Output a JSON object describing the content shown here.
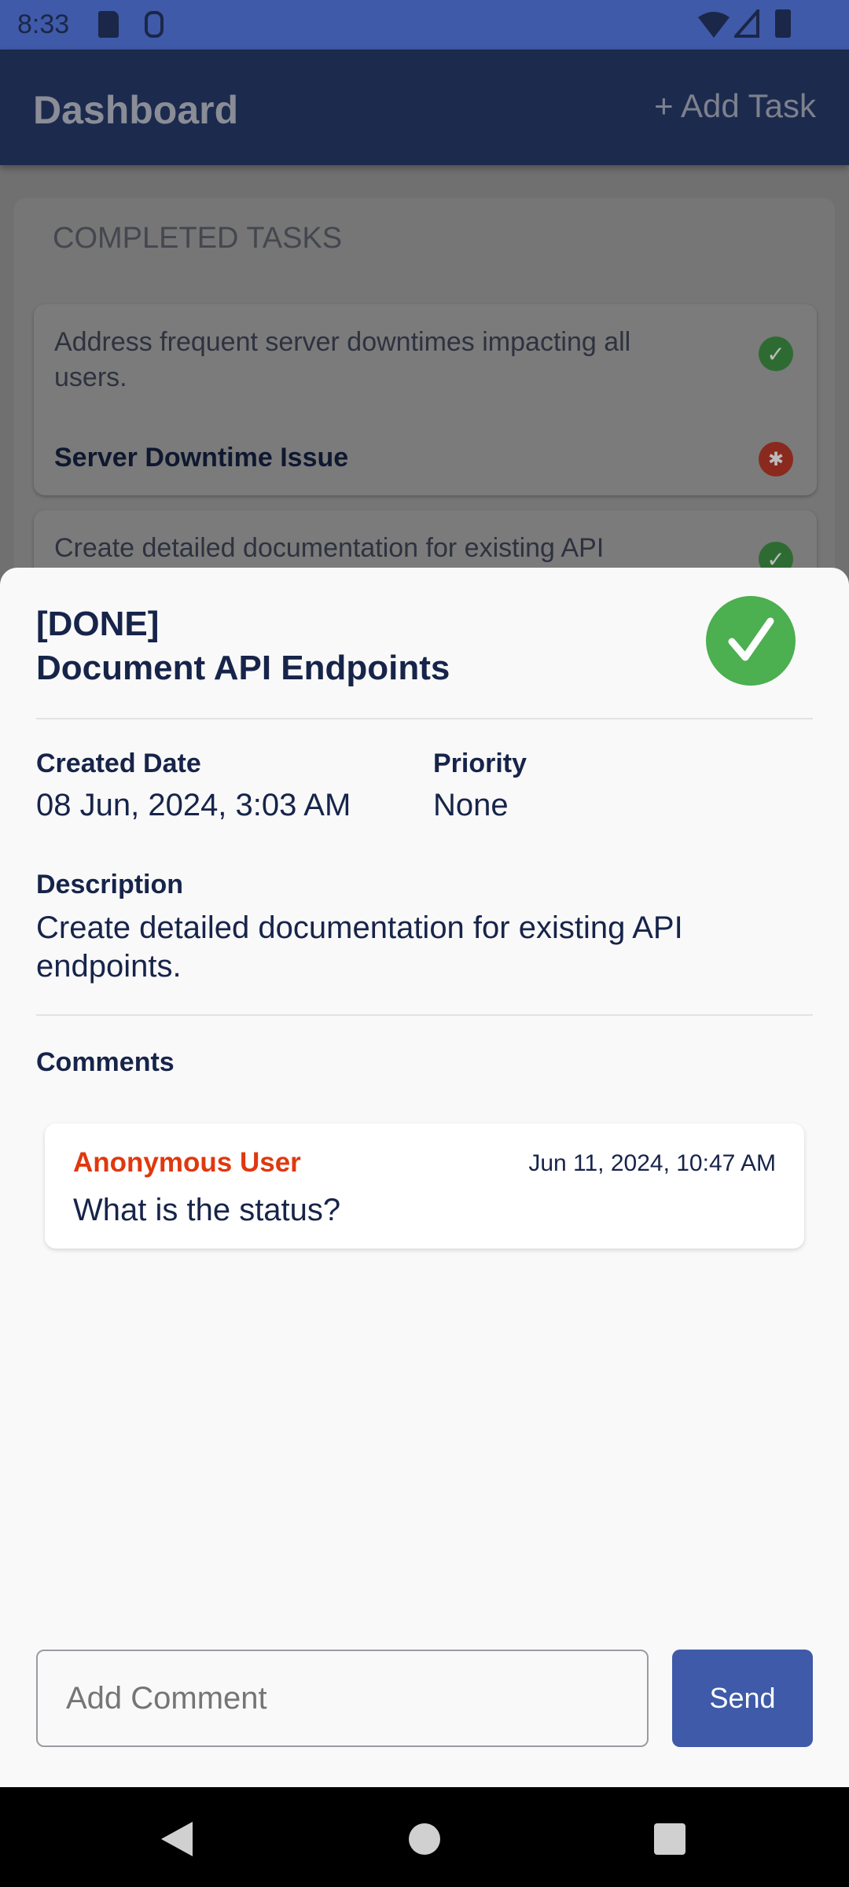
{
  "status_bar": {
    "time": "8:33",
    "icons": [
      "sd-card-icon",
      "robot-icon",
      "wifi-icon",
      "signal-icon",
      "battery-icon"
    ]
  },
  "app_bar": {
    "title": "Dashboard",
    "add_task": "+ Add Task"
  },
  "background": {
    "section_title": "COMPLETED TASKS",
    "tasks": [
      {
        "description": "Address frequent server downtimes impacting all users.",
        "name": "Server Downtime Issue",
        "status_icon": "check-circle-icon",
        "type_icon": "bug-icon"
      },
      {
        "description": "Create detailed documentation for existing API",
        "status_icon": "check-circle-icon"
      }
    ]
  },
  "sheet": {
    "status": "[DONE]",
    "title": "Document API Endpoints",
    "created_label": "Created Date",
    "created_value": "08 Jun, 2024, 3:03 AM",
    "priority_label": "Priority",
    "priority_value": "None",
    "description_label": "Description",
    "description_value": "Create detailed documentation for existing API endpoints.",
    "comments_label": "Comments",
    "comments": [
      {
        "author": "Anonymous User",
        "date": "Jun 11, 2024, 10:47 AM",
        "text": "What is the status?"
      }
    ],
    "input_placeholder": "Add Comment",
    "send_label": "Send"
  },
  "colors": {
    "accent": "#3f5aa8",
    "done": "#4caf50",
    "author": "#e0380e",
    "navy": "#17244a"
  }
}
